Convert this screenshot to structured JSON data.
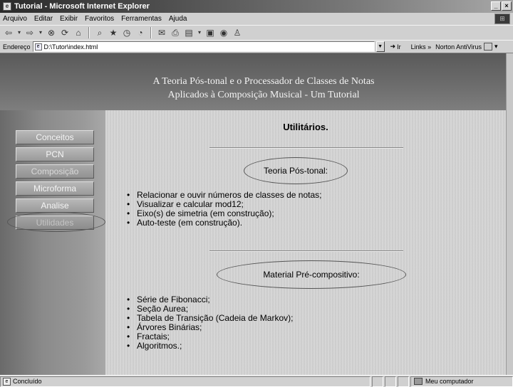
{
  "window": {
    "title": "Tutorial - Microsoft Internet Explorer",
    "controls": [
      "_",
      "×"
    ]
  },
  "menu": {
    "items": [
      "Arquivo",
      "Editar",
      "Exibir",
      "Favoritos",
      "Ferramentas",
      "Ajuda"
    ]
  },
  "address": {
    "label": "Endereço",
    "value": "D:\\Tutor\\index.html",
    "go_label": "Ir",
    "links_label": "Links »",
    "norton_label": "Norton AntiVirus"
  },
  "header": {
    "line1": "A Teoria Pós-tonal e o Processador de Classes de Notas",
    "line2": "Aplicados à Composição Musical - Um Tutorial"
  },
  "nav": {
    "items": [
      "Conceitos",
      "PCN",
      "Composição",
      "Microforma",
      "Analise",
      "Utilidades"
    ]
  },
  "content": {
    "title": "Utilitários.",
    "section1": {
      "heading": "Teoria Pós-tonal:",
      "items": [
        "Relacionar e ouvir números de classes de notas;",
        "Visualizar e calcular mod12;",
        "Eixo(s) de simetria (em construção);",
        "Auto-teste (em construção)."
      ]
    },
    "section2": {
      "heading": "Material Pré-compositivo:",
      "items": [
        "Série de Fibonacci;",
        "Seção Aurea;",
        "Tabela de Transição (Cadeia de Markov);",
        "Árvores Binárias;",
        "Fractais;",
        "Algoritmos.;"
      ]
    }
  },
  "status": {
    "text": "Concluído",
    "zone": "Meu computador"
  },
  "icons": {
    "toolbar": [
      "back-icon",
      "forward-icon",
      "stop-icon",
      "refresh-icon",
      "home-icon",
      "search-icon",
      "favorites-icon",
      "history-icon",
      "mail-icon",
      "print-icon",
      "edit-icon",
      "discuss-icon",
      "messenger-icon"
    ]
  }
}
